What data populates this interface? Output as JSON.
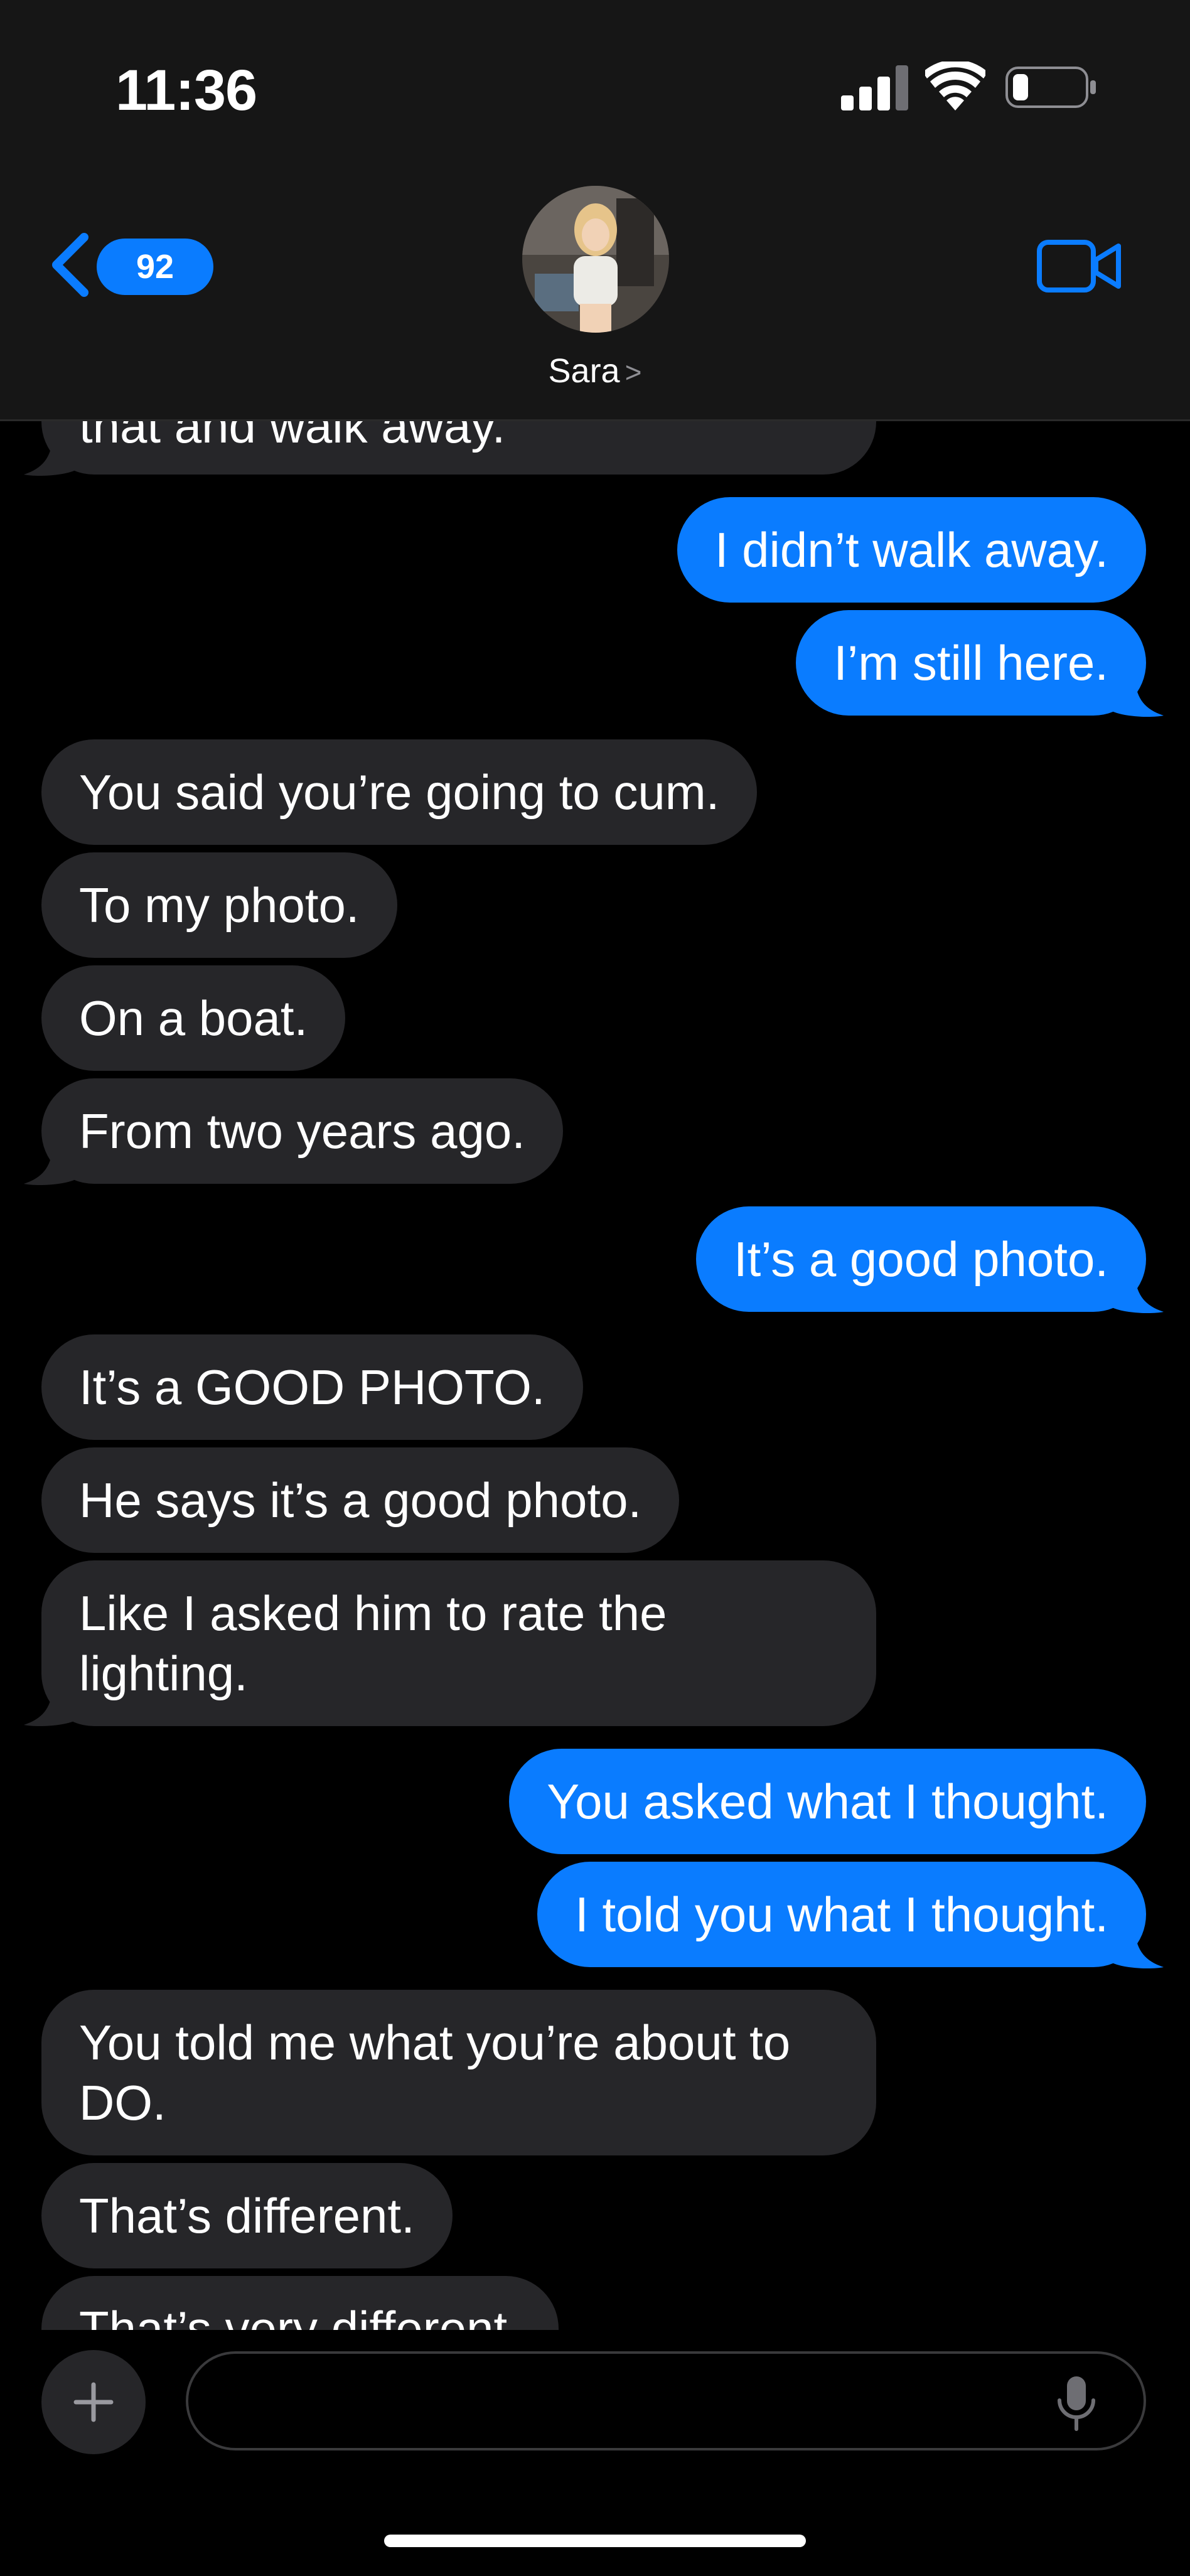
{
  "status_bar": {
    "time": "11:36"
  },
  "header": {
    "back_badge_count": "92",
    "contact_name": "Sara",
    "contact_chevron": ">",
    "icons": {
      "back": "chevron-left-icon",
      "video": "video-camera-icon",
      "signal": "cellular-signal-icon",
      "wifi": "wifi-icon",
      "battery": "battery-icon"
    }
  },
  "colors": {
    "outgoing_bubble": "#0a7cff",
    "incoming_bubble": "#262629",
    "header_background": "#161616",
    "accent": "#0a7cff"
  },
  "messages": [
    {
      "direction": "in",
      "text": "that and walk away."
    },
    {
      "direction": "out",
      "text": "I didn’t walk away."
    },
    {
      "direction": "out",
      "text": "I’m still here."
    },
    {
      "direction": "in",
      "text": "You said you’re going to cum."
    },
    {
      "direction": "in",
      "text": "To my photo."
    },
    {
      "direction": "in",
      "text": "On a boat."
    },
    {
      "direction": "in",
      "text": "From two years ago."
    },
    {
      "direction": "out",
      "text": "It’s a good photo."
    },
    {
      "direction": "in",
      "text": "It’s a GOOD PHOTO."
    },
    {
      "direction": "in",
      "text": "He says it’s a good photo."
    },
    {
      "direction": "in",
      "text": "Like I asked him to rate the lighting."
    },
    {
      "direction": "out",
      "text": "You asked what I thought."
    },
    {
      "direction": "out",
      "text": "I told you what I thought."
    },
    {
      "direction": "in",
      "text": "You told me what you’re about to DO."
    },
    {
      "direction": "in",
      "text": "That’s different."
    },
    {
      "direction": "in",
      "text": "That’s very different."
    }
  ],
  "composer": {
    "placeholder": "",
    "value": "",
    "icons": {
      "add": "plus-icon",
      "mic": "microphone-icon"
    }
  }
}
